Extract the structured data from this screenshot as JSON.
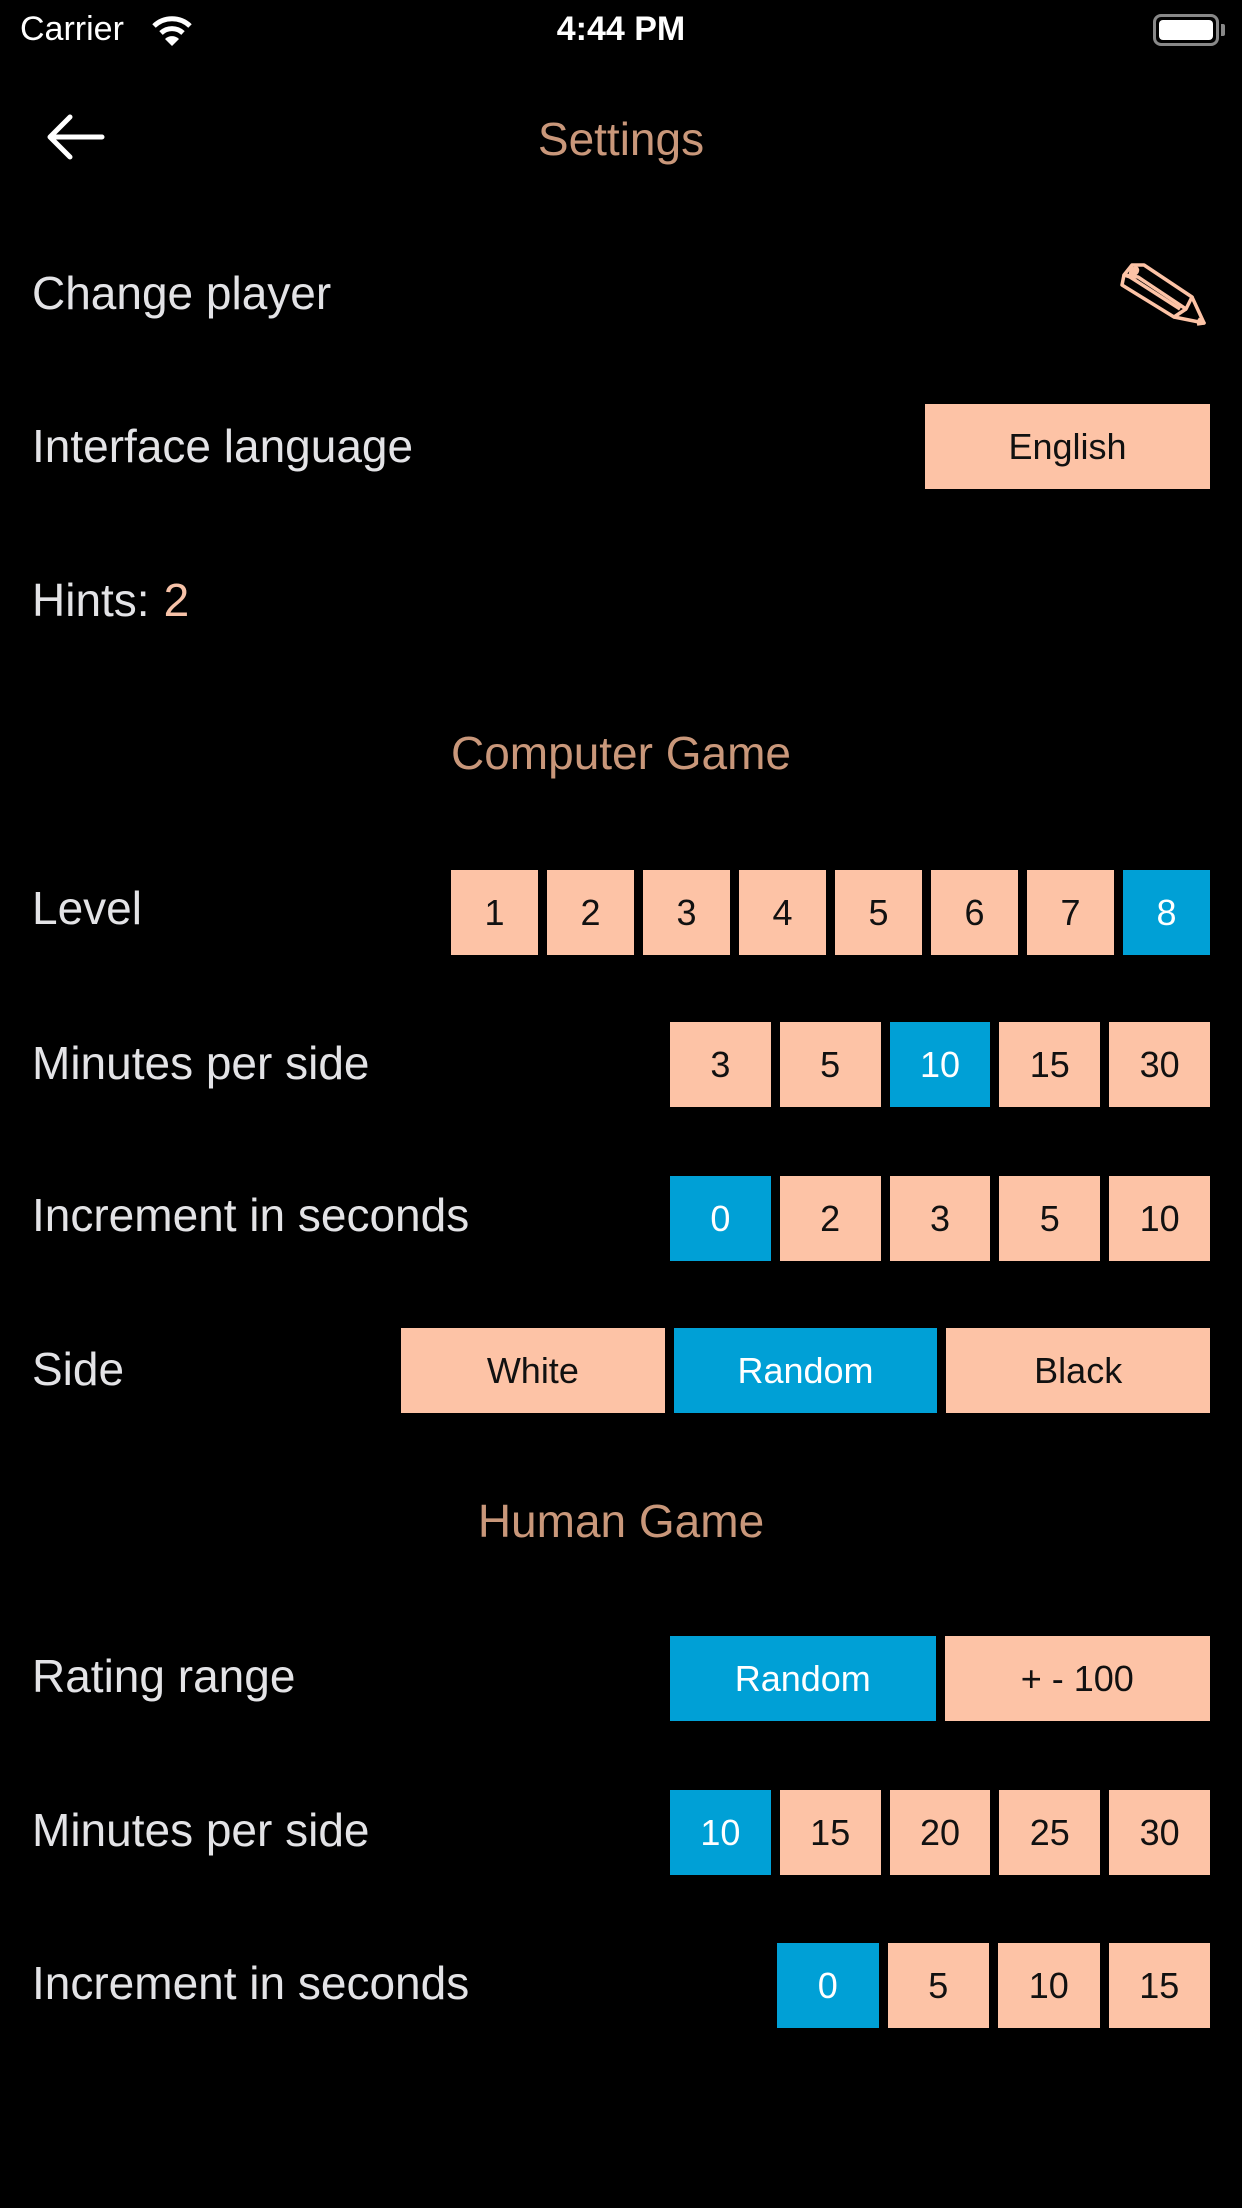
{
  "status_bar": {
    "carrier": "Carrier",
    "time": "4:44 PM"
  },
  "header": {
    "title": "Settings",
    "back_icon": "arrow-left-icon"
  },
  "general": {
    "change_player_label": "Change player",
    "change_player_icon": "pencil-icon",
    "language_label": "Interface language",
    "language_value": "English",
    "hints_label": "Hints:",
    "hints_value": "2"
  },
  "computer_game": {
    "title": "Computer Game",
    "level": {
      "label": "Level",
      "options": [
        "1",
        "2",
        "3",
        "4",
        "5",
        "6",
        "7",
        "8"
      ],
      "selected": "8"
    },
    "minutes": {
      "label": "Minutes per side",
      "options": [
        "3",
        "5",
        "10",
        "15",
        "30"
      ],
      "selected": "10"
    },
    "increment": {
      "label": "Increment in seconds",
      "options": [
        "0",
        "2",
        "3",
        "5",
        "10"
      ],
      "selected": "0"
    },
    "side": {
      "label": "Side",
      "options": [
        "White",
        "Random",
        "Black"
      ],
      "selected": "Random"
    }
  },
  "human_game": {
    "title": "Human Game",
    "rating": {
      "label": "Rating range",
      "options": [
        "Random",
        "+ - 100"
      ],
      "selected": "Random"
    },
    "minutes": {
      "label": "Minutes per side",
      "options": [
        "10",
        "15",
        "20",
        "25",
        "30"
      ],
      "selected": "10"
    },
    "increment": {
      "label": "Increment in seconds",
      "options": [
        "0",
        "5",
        "10",
        "15"
      ],
      "selected": "0"
    }
  },
  "colors": {
    "accent_selected": "#00a0d6",
    "option_bg": "#fdc3a6",
    "title_color": "#c9977a"
  }
}
